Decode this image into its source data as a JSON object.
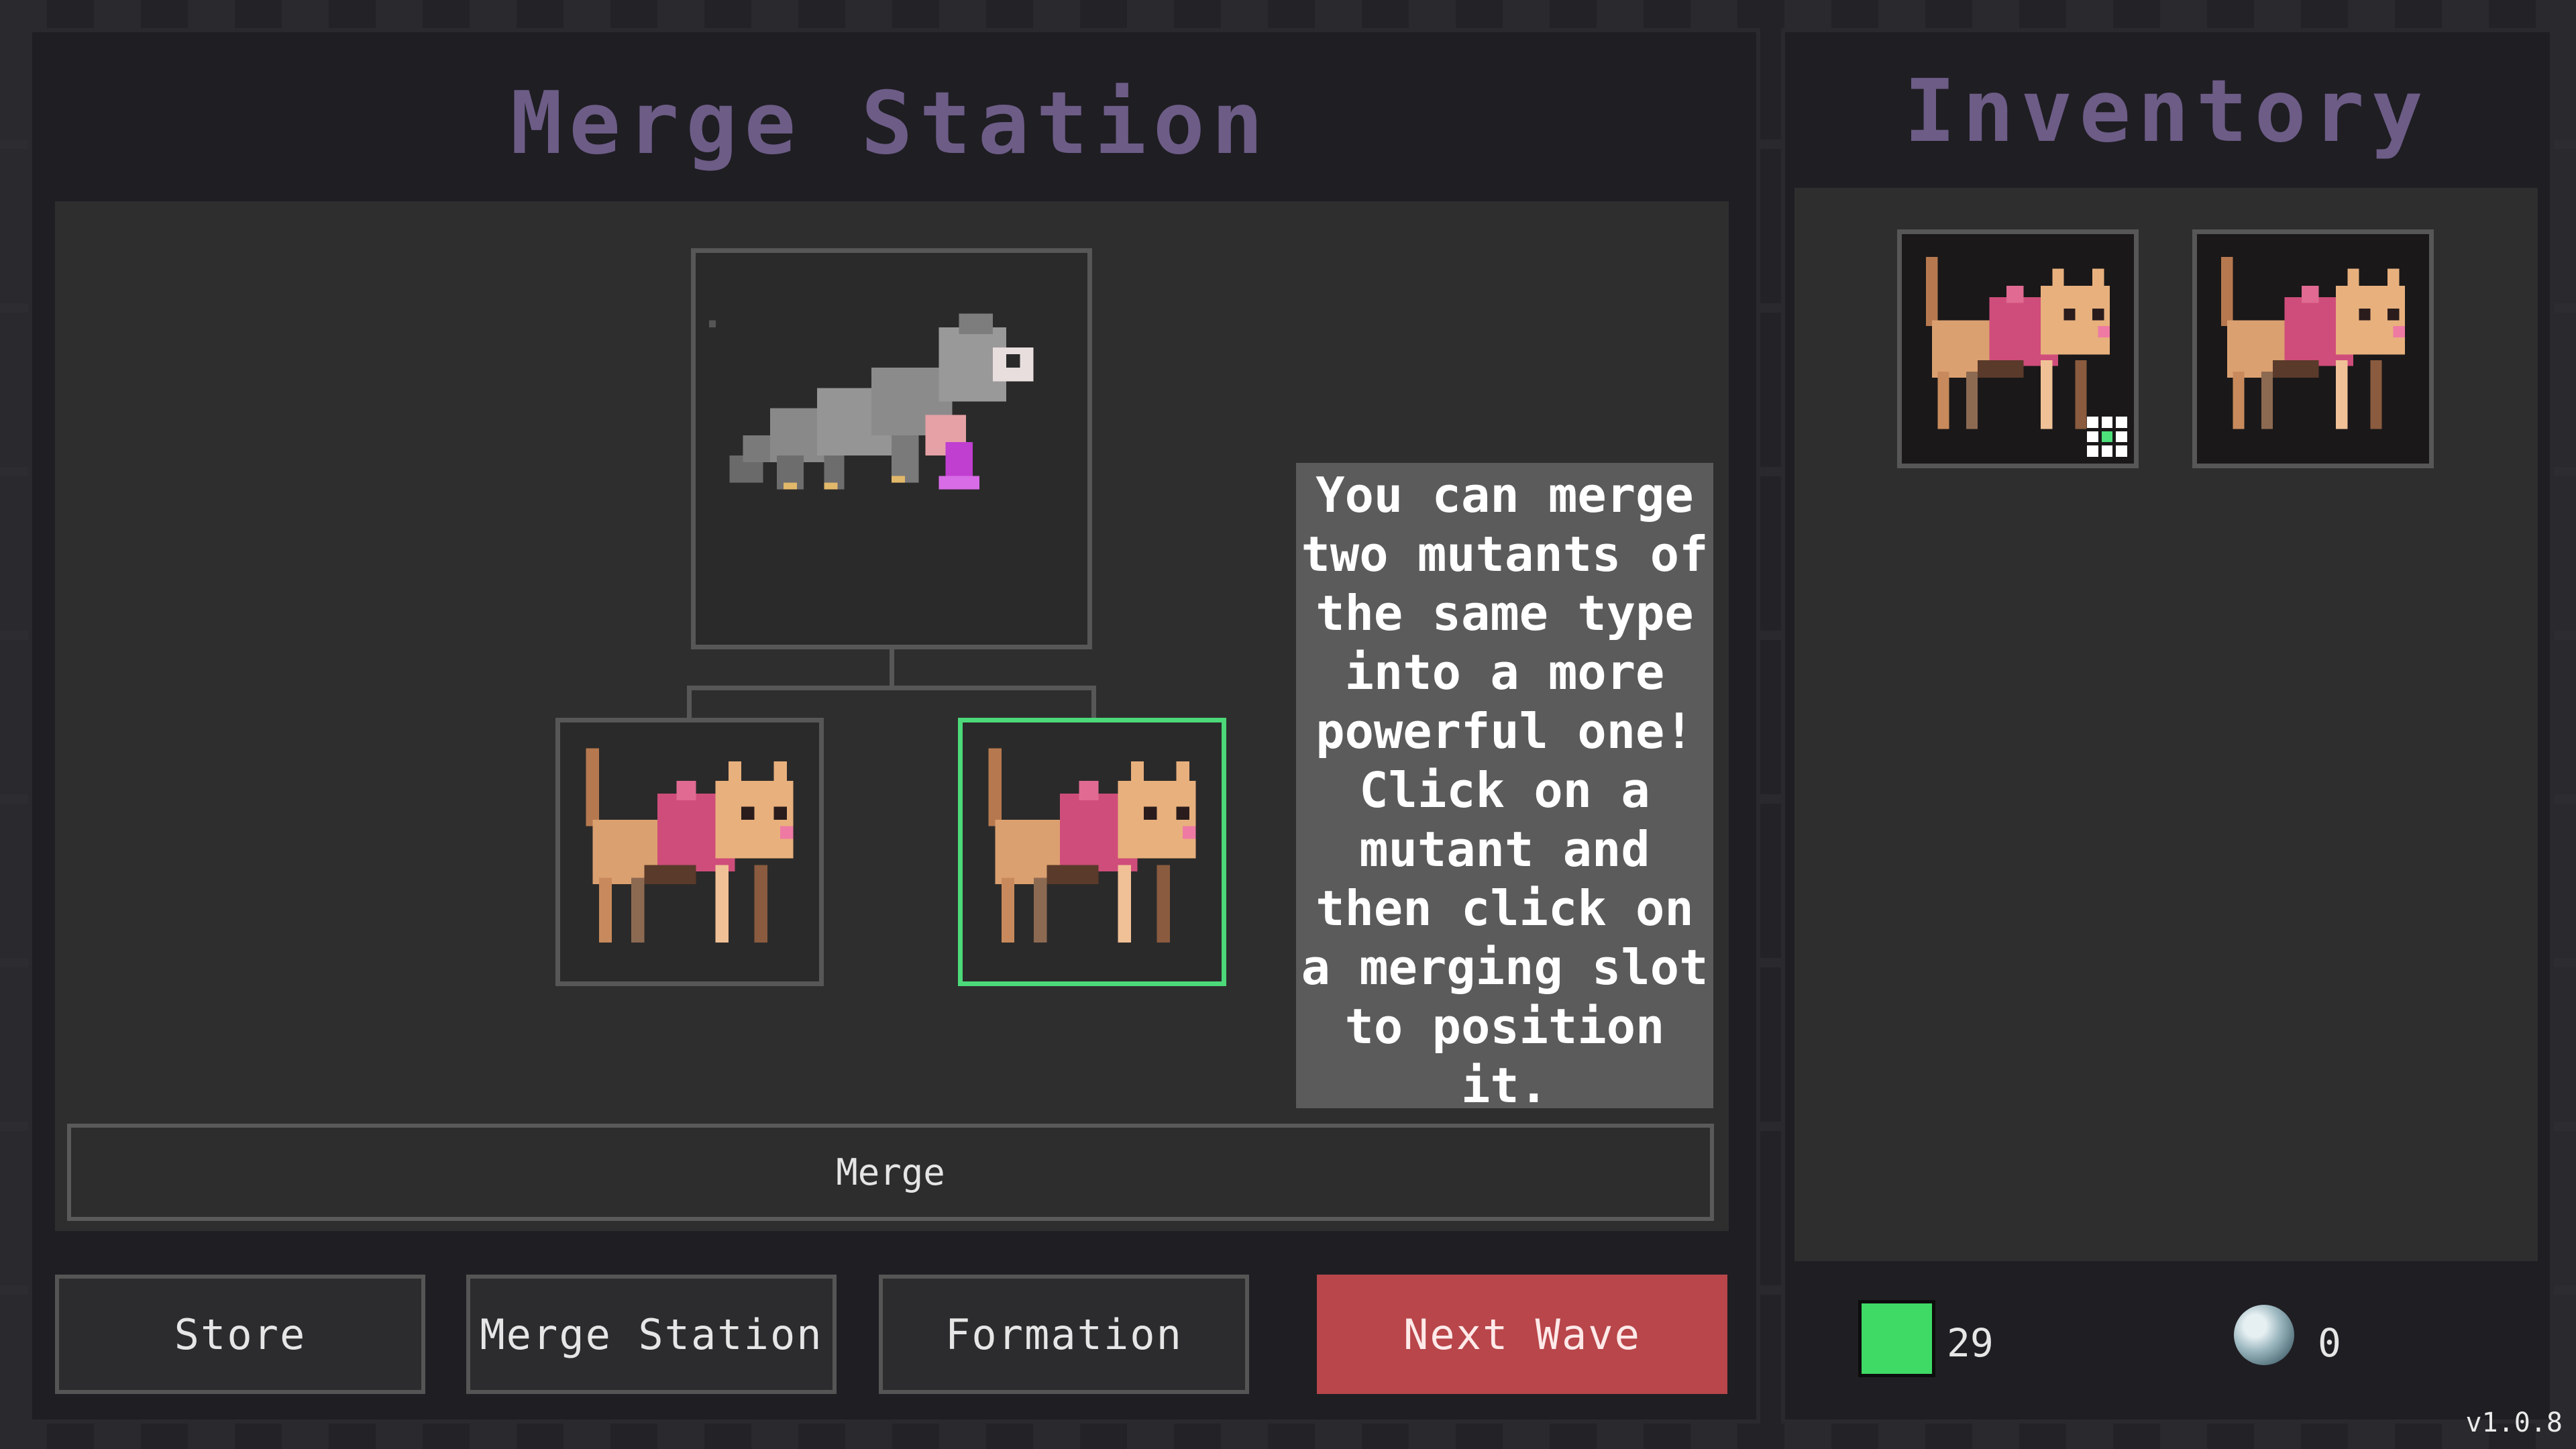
{
  "merge_station": {
    "title": "Merge Station",
    "result_slot_icon": "grey-wolf-mutant-icon",
    "input_slots": [
      {
        "icon": "mutant-cat-icon",
        "selected": false
      },
      {
        "icon": "mutant-cat-icon",
        "selected": true
      }
    ],
    "tooltip": "You can merge\ntwo mutants of\nthe same type\ninto a more\npowerful one!\nClick on a\nmutant and\nthen click on\na merging slot\nto position\nit.",
    "merge_button": "Merge"
  },
  "nav": {
    "store": "Store",
    "merge_station": "Merge Station",
    "formation": "Formation",
    "next_wave": "Next Wave"
  },
  "inventory": {
    "title": "Inventory",
    "items": [
      {
        "icon": "mutant-cat-icon",
        "has_formation_badge": true
      },
      {
        "icon": "mutant-cat-icon",
        "has_formation_badge": false
      }
    ],
    "resources": {
      "gems": "29",
      "orbs": "0"
    }
  },
  "version": "v1.0.8",
  "colors": {
    "selected_border": "#4cd97a",
    "next_wave": "#b8464a",
    "title": "#6c5c86"
  }
}
